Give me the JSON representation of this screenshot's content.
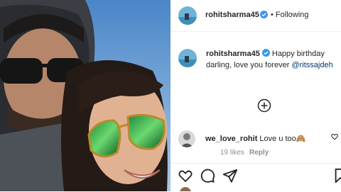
{
  "post": {
    "author": "rohitsharma45",
    "follow_label": "• Following",
    "caption_user": "rohitsharma45",
    "caption_text": " Happy birthday darling, love you forever ",
    "caption_mention": "@ritssajdeh"
  },
  "comment": {
    "user": "we_love_rohit",
    "text": " Love u too🙈",
    "likes": "19 likes",
    "reply_label": "Reply"
  },
  "icons": {
    "verified": "verified-badge-icon",
    "add": "plus-circle-icon",
    "like": "heart-icon",
    "comment": "comment-icon",
    "share": "share-icon",
    "save": "bookmark-icon"
  },
  "colors": {
    "verified": "#3897f0",
    "mention": "#00376b",
    "muted": "#8e8e8e"
  }
}
